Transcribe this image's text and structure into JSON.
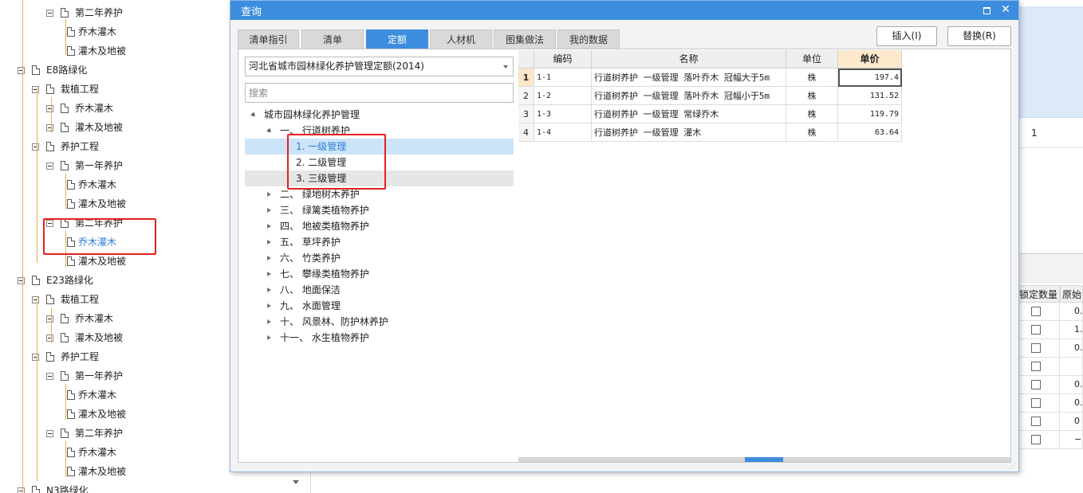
{
  "background_tree": {
    "rows": [
      {
        "label": "第二年养护",
        "level": 2
      },
      {
        "label": "乔木灌木",
        "level": 3
      },
      {
        "label": "灌木及地被",
        "level": 3
      },
      {
        "label": "E8路绿化",
        "level": 0
      },
      {
        "label": "栽植工程",
        "level": 1
      },
      {
        "label": "乔木灌木",
        "level": 2
      },
      {
        "label": "灌木及地被",
        "level": 2
      },
      {
        "label": "养护工程",
        "level": 1
      },
      {
        "label": "第一年养护",
        "level": 2
      },
      {
        "label": "乔木灌木",
        "level": 3
      },
      {
        "label": "灌木及地被",
        "level": 3
      },
      {
        "label": "第二年养护",
        "level": 2
      },
      {
        "label": "乔木灌木",
        "level": 3,
        "selected": true
      },
      {
        "label": "灌木及地被",
        "level": 3
      },
      {
        "label": "E23路绿化",
        "level": 0
      },
      {
        "label": "栽植工程",
        "level": 1
      },
      {
        "label": "乔木灌木",
        "level": 2
      },
      {
        "label": "灌木及地被",
        "level": 2
      },
      {
        "label": "养护工程",
        "level": 1
      },
      {
        "label": "第一年养护",
        "level": 2
      },
      {
        "label": "乔木灌木",
        "level": 3
      },
      {
        "label": "灌木及地被",
        "level": 3
      },
      {
        "label": "第二年养护",
        "level": 2
      },
      {
        "label": "乔木灌木",
        "level": 3
      },
      {
        "label": "灌木及地被",
        "level": 3
      },
      {
        "label": "N3路绿化",
        "level": 0
      }
    ]
  },
  "right_panel": {
    "row_value": "1",
    "headers": [
      "锁定数量",
      "原始"
    ],
    "rows": [
      "0.",
      "1.",
      "0.",
      "",
      "0.",
      "0.",
      "0",
      "−"
    ]
  },
  "dialog": {
    "title": "查询",
    "tabs": [
      {
        "label": "清单指引",
        "active": false
      },
      {
        "label": "清单",
        "active": false
      },
      {
        "label": "定额",
        "active": true
      },
      {
        "label": "人材机",
        "active": false
      },
      {
        "label": "图集做法",
        "active": false
      },
      {
        "label": "我的数据",
        "active": false
      }
    ],
    "insert_label": "插入(I)",
    "replace_label": "替换(R)",
    "database_select": "河北省城市园林绿化养护管理定额(2014)",
    "search_placeholder": "搜索",
    "tree": {
      "root": "城市园林绿化养护管理",
      "expanded": "一、  行道树养护",
      "children": [
        "1. 一级管理",
        "2. 二级管理",
        "3. 三级管理"
      ],
      "sections": [
        "二、  绿地树木养护",
        "三、  绿篱类植物养护",
        "四、  地被类植物养护",
        "五、  草坪养护",
        "六、  竹类养护",
        "七、  攀缘类植物养护",
        "八、  地面保洁",
        "九、  水面管理",
        "十、  风景林、防护林养护",
        "十一、  水生植物养护"
      ]
    },
    "grid": {
      "headers": {
        "code": "编码",
        "name": "名称",
        "unit": "单位",
        "price": "单价"
      },
      "rows": [
        {
          "no": "1",
          "code": "1-1",
          "name": "行道树养护 一级管理 落叶乔木 冠幅大于5m",
          "unit": "株",
          "price": "197.4"
        },
        {
          "no": "2",
          "code": "1-2",
          "name": "行道树养护 一级管理 落叶乔木 冠幅小于5m",
          "unit": "株",
          "price": "131.52"
        },
        {
          "no": "3",
          "code": "1-3",
          "name": "行道树养护 一级管理 常绿乔木",
          "unit": "株",
          "price": "119.79"
        },
        {
          "no": "4",
          "code": "1-4",
          "name": "行道树养护 一级管理 灌木",
          "unit": "株",
          "price": "63.64"
        }
      ]
    }
  },
  "colors": {
    "accent": "#3c8dde",
    "highlight": "#e52020",
    "tree_line": "#e6b24a",
    "selected_text": "#2d7fd8"
  }
}
